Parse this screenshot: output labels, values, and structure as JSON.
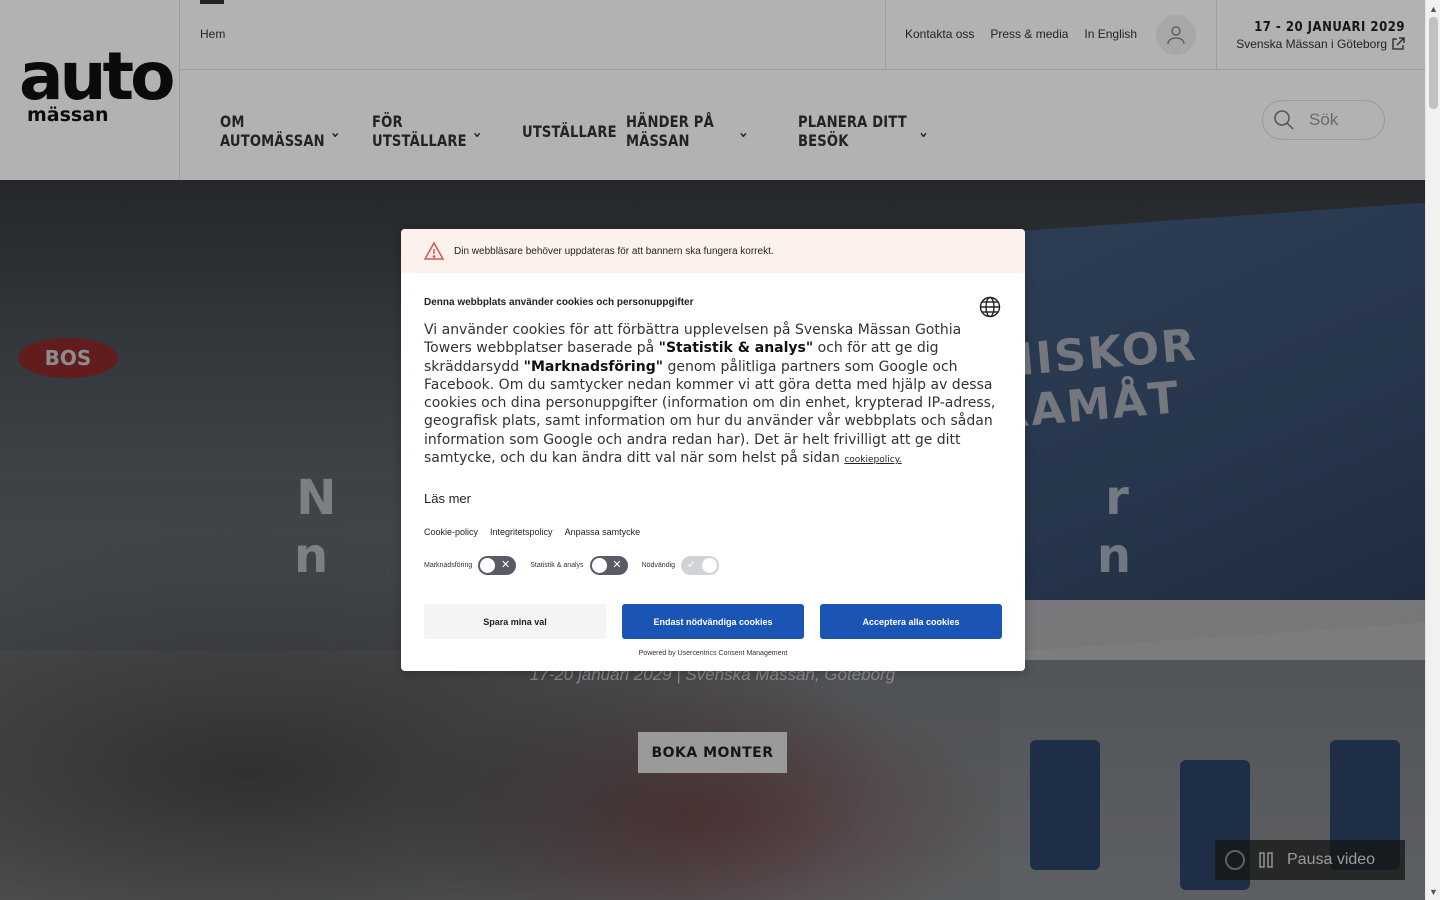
{
  "logo": {
    "word_top": "auto",
    "word_bottom": "mässan"
  },
  "topbar": {
    "breadcrumb_home": "Hem",
    "util_links": [
      "Kontakta oss",
      "Press & media",
      "In English"
    ],
    "event_date": "17 - 20 JANUARI 2029",
    "event_venue": "Svenska Mässan i Göteborg"
  },
  "nav": {
    "items": [
      {
        "label": "OM AUTOMÄSSAN",
        "has_dropdown": true
      },
      {
        "label": "FÖR UTSTÄLLARE",
        "has_dropdown": true
      },
      {
        "label": "UTSTÄLLARE",
        "has_dropdown": false
      },
      {
        "label": "HÄNDER PÅ MÄSSAN",
        "has_dropdown": true
      },
      {
        "label": "PLANERA DITT BESÖK",
        "has_dropdown": true
      }
    ],
    "search_placeholder": "Sök"
  },
  "hero": {
    "sign_text": "BOS",
    "banner_text": "NNISKOR FRAMÅT",
    "headline_line1": "N                                              r",
    "headline_line2": "n                                              n",
    "subtitle": "17-20 januari 2029 | Svenska Mässan, Göteborg",
    "cta_label": "BOKA MONTER",
    "video_control_label": "Pausa video"
  },
  "cookie": {
    "warning": "Din webbläsare behöver uppdateras för att bannern ska fungera korrekt.",
    "title": "Denna webbplats använder cookies och personuppgifter",
    "body_part1": "Vi använder cookies för att förbättra upplevelsen på Svenska Mässan Gothia Towers webbplatser baserade på ",
    "body_bold1": "\"Statistik & analys\"",
    "body_part2": " och för att ge dig skräddarsydd ",
    "body_bold2": "\"Marknadsföring\"",
    "body_part3": " genom pålitliga partners som Google och Facebook. Om du samtycker nedan kommer vi att göra detta med hjälp av dessa cookies och dina personuppgifter (information om din enhet, krypterad IP-adress, geografisk plats, samt information om hur du använder vår webbplats och sådan information som Google och andra redan har). Det är helt frivilligt att ge ditt samtycke, och du kan ändra ditt val när som helst på sidan ",
    "policy_link": "cookiepolicy.",
    "read_more": "Läs mer",
    "links": [
      "Cookie-policy",
      "Integritetspolicy",
      "Anpassa samtycke"
    ],
    "toggles": [
      {
        "label": "Marknadsföring",
        "on": false,
        "disabled": false
      },
      {
        "label": "Statistik & analys",
        "on": false,
        "disabled": false
      },
      {
        "label": "Nödvändig",
        "on": true,
        "disabled": true
      }
    ],
    "buttons": {
      "save": "Spara mina val",
      "necessary_only": "Endast nödvändiga cookies",
      "accept_all": "Acceptera alla cookies"
    },
    "powered_by": "Powered by Usercentrics Consent Management"
  },
  "colors": {
    "primary_button": "#1a55b5",
    "warning_bg": "#fdf1ee",
    "warning_icon": "#d9534f"
  }
}
